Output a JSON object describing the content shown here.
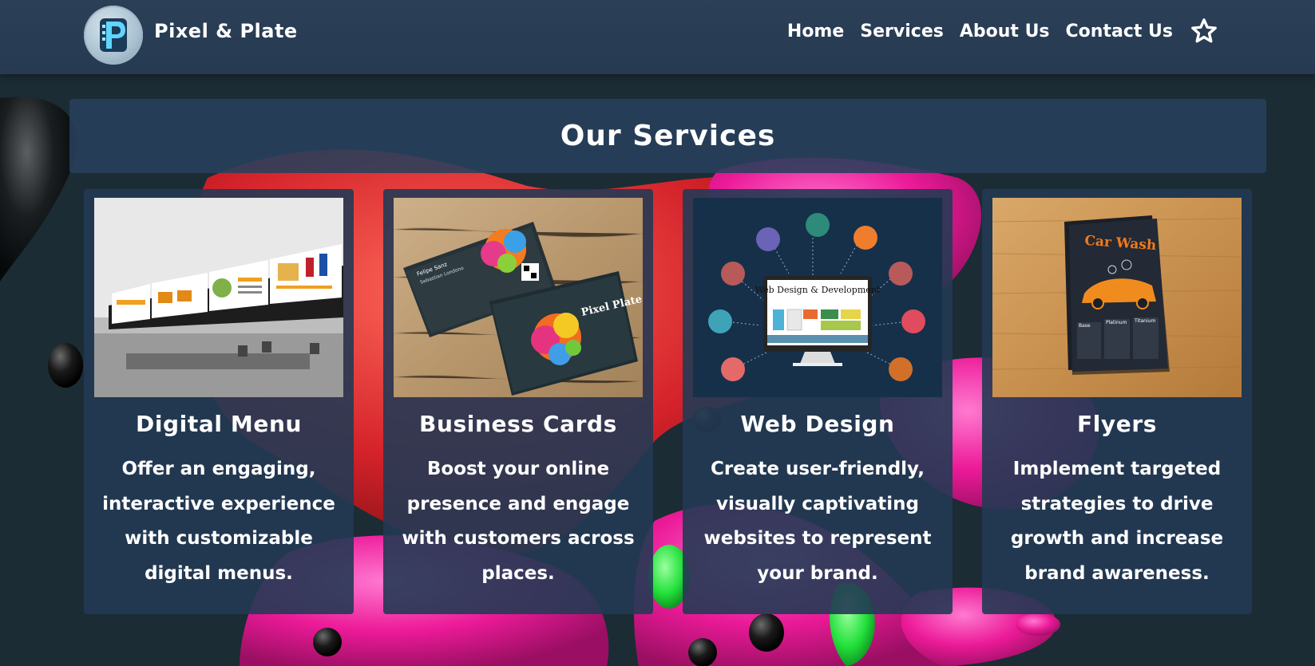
{
  "header": {
    "brand": "Pixel & Plate",
    "logo_icon": "pixel-plate-p-logo-icon",
    "nav": [
      "Home",
      "Services",
      "About Us",
      "Contact Us"
    ],
    "star_icon": "star-icon"
  },
  "main": {
    "title": "Our Services",
    "cards": [
      {
        "title": "Digital Menu",
        "description": "Offer an engaging, interactive experience with customizable digital menus.",
        "image": "digital-menu-boards-photo"
      },
      {
        "title": "Business Cards",
        "description": "Boost your online presence and engage with customers across places.",
        "image": "business-cards-photo",
        "image_text": {
          "name": "Felipe Sanz",
          "title": "Sebastian Londono",
          "brand": "Pixel Plate"
        }
      },
      {
        "title": "Web Design",
        "description": "Create user-friendly, visually captivating websites to represent your brand.",
        "image": "web-design-illustration",
        "image_text": "Web Design & Development"
      },
      {
        "title": "Flyers",
        "description": "Implement targeted strategies to drive growth and increase brand awareness.",
        "image": "car-wash-flyer-photo",
        "image_text": {
          "headline": "Car Wash",
          "tiers": [
            "Base",
            "Platinum",
            "Titanium"
          ]
        }
      }
    ]
  },
  "colors": {
    "header_bg": "#2b3f57",
    "card_bg": "#243a54",
    "page_bg": "#1b2c34",
    "splash_pink": "#ee1a9a",
    "splash_red": "#d8232a",
    "splash_green": "#22e03a"
  }
}
